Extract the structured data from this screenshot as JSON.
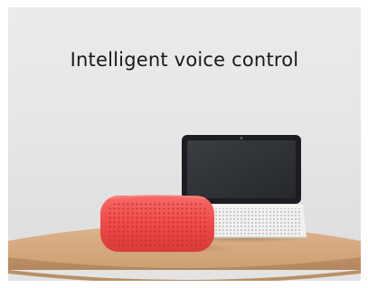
{
  "caption": "Intelligent voice control",
  "products": [
    {
      "name": "smart-speaker",
      "color": "#f04848"
    },
    {
      "name": "smart-display",
      "color": "#2a2a2a"
    }
  ],
  "colors": {
    "background": "#e8e7e8",
    "table": "#d3a67c"
  }
}
